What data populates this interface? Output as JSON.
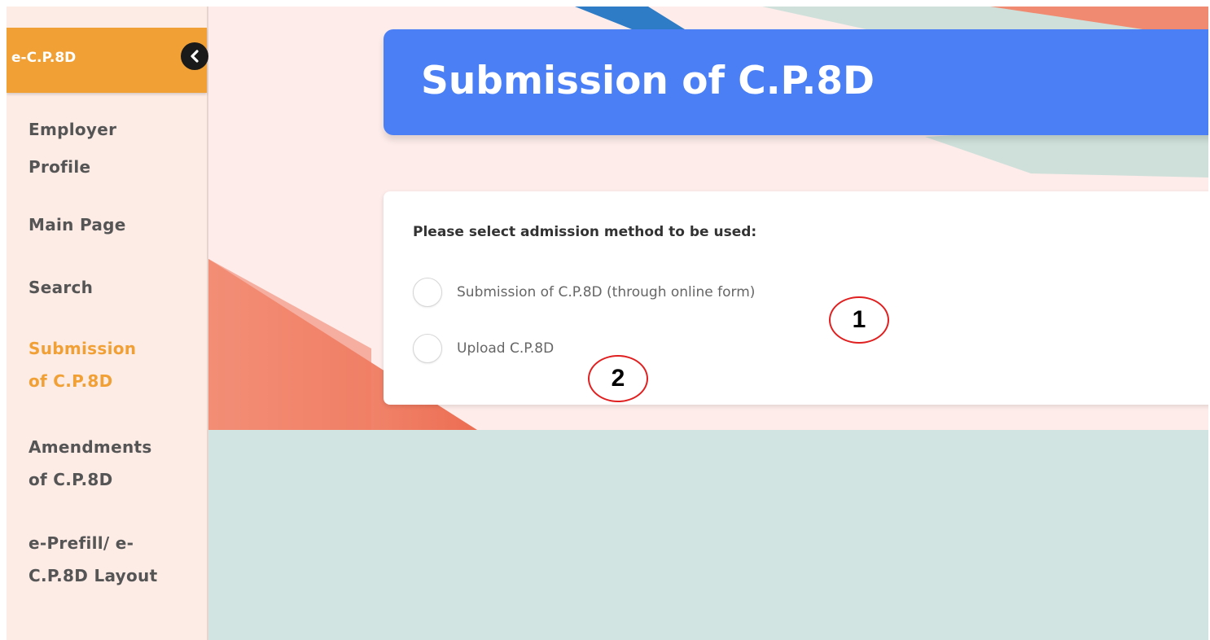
{
  "sidebar": {
    "header_title": "e-C.P.8D",
    "collapse_icon": "chevron-left-icon",
    "items": [
      {
        "lines": [
          "Employer",
          "Profile"
        ],
        "active": false
      },
      {
        "lines": [
          "Main Page"
        ],
        "active": false
      },
      {
        "lines": [
          "Search"
        ],
        "active": false
      },
      {
        "lines": [
          "Submission",
          "of C.P.8D"
        ],
        "active": true
      },
      {
        "lines": [
          "Amendments",
          "of C.P.8D"
        ],
        "active": false
      },
      {
        "lines": [
          "e-Prefill/ e-",
          "C.P.8D Layout"
        ],
        "active": false
      }
    ]
  },
  "main": {
    "page_title": "Submission of C.P.8D",
    "question": "Please select admission method to be used:",
    "options": [
      {
        "label": "Submission of C.P.8D (through online form)",
        "selected": false
      },
      {
        "label": "Upload C.P.8D",
        "selected": false
      }
    ]
  },
  "annotations": [
    "1",
    "2"
  ],
  "colors": {
    "accent_orange": "#f1a035",
    "banner_blue": "#4a7ff5",
    "annotation_red": "#e02020",
    "background_pink": "#fdecea",
    "background_teal": "#d2e4e1"
  }
}
